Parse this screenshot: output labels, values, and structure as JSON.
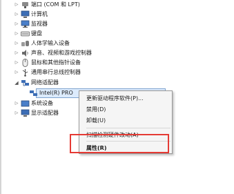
{
  "tree": {
    "items": [
      {
        "label": "端口 (COM 和 LPT)",
        "icon": "port-icon"
      },
      {
        "label": "计算机",
        "icon": "computer-icon"
      },
      {
        "label": "监视器",
        "icon": "monitor-icon"
      },
      {
        "label": "键盘",
        "icon": "keyboard-icon"
      },
      {
        "label": "人体学输入设备",
        "icon": "hid-icon"
      },
      {
        "label": "声音、视频和游戏控制器",
        "icon": "speaker-icon"
      },
      {
        "label": "鼠标和其他指针设备",
        "icon": "mouse-icon"
      },
      {
        "label": "通用串行总线控制器",
        "icon": "usb-icon"
      },
      {
        "label": "网络适配器",
        "icon": "network-icon"
      },
      {
        "label": "Intel(R) PRO",
        "icon": "network-adapter-icon"
      },
      {
        "label": "系统设备",
        "icon": "system-device-icon"
      },
      {
        "label": "显示适配器",
        "icon": "display-adapter-icon"
      }
    ]
  },
  "context_menu": {
    "items": [
      {
        "label": "更新驱动程序软件(P)..."
      },
      {
        "label": "禁用(D)"
      },
      {
        "label": "卸载(U)"
      },
      {
        "label": "扫描检测硬件改动(A)"
      },
      {
        "label": "属性(R)"
      }
    ]
  },
  "colors": {
    "highlight_box": "#e53a34",
    "selection": "#dcebfc"
  }
}
